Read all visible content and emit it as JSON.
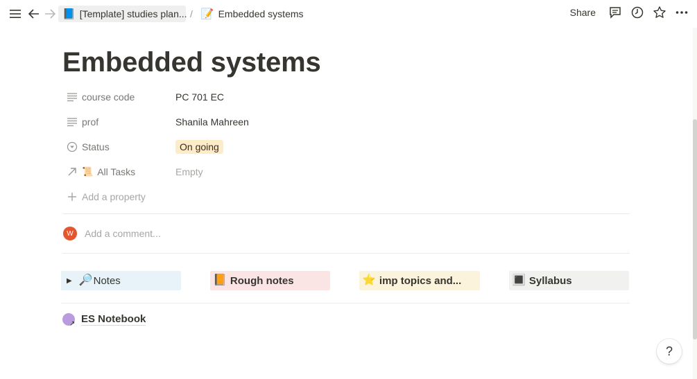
{
  "topbar": {
    "menu_icon": "hamburger-icon",
    "back_icon": "arrow-left-icon",
    "forward_icon": "arrow-right-icon",
    "breadcrumbs": [
      {
        "emoji": "📘",
        "label": "[Template] studies plan..."
      },
      {
        "emoji": "📝",
        "label": "Embedded systems"
      }
    ],
    "separator": "/",
    "share_label": "Share",
    "actions": [
      "comment-icon",
      "clock-icon",
      "star-icon",
      "more-icon"
    ]
  },
  "page": {
    "title": "Embedded systems",
    "properties": [
      {
        "icon": "text-lines-icon",
        "name": "course code",
        "value": "PC 701 EC",
        "type": "text"
      },
      {
        "icon": "text-lines-icon",
        "name": "prof",
        "value": "Shanila Mahreen",
        "type": "text"
      },
      {
        "icon": "select-icon",
        "name": "Status",
        "value": "On going",
        "type": "status"
      },
      {
        "icon": "relation-arrow-icon",
        "name_emoji": "📜",
        "name": "All Tasks",
        "value": "Empty",
        "type": "relation"
      }
    ],
    "add_property_label": "Add a property",
    "comment": {
      "avatar_letter": "W",
      "placeholder": "Add a comment..."
    }
  },
  "cards": [
    {
      "emoji": "🔎",
      "label": "Notes",
      "toggle": "▶"
    },
    {
      "emoji": "📙",
      "label": "Rough notes"
    },
    {
      "emoji": "⭐",
      "label": "imp topics and..."
    },
    {
      "emoji": "🔳",
      "label": "Syllabus"
    }
  ],
  "link": {
    "label": "ES Notebook",
    "arrow": "↗"
  },
  "help_label": "?",
  "colors": {
    "status_badge_bg": "#fdecc8",
    "notes_bg": "#e7f3f8",
    "rough_bg": "#fbe4e4",
    "imp_bg": "#fbf3db",
    "syllabus_bg": "#f1f1ef",
    "avatar_bg": "#e4572e",
    "notebook_circle": "#b89cdd"
  }
}
